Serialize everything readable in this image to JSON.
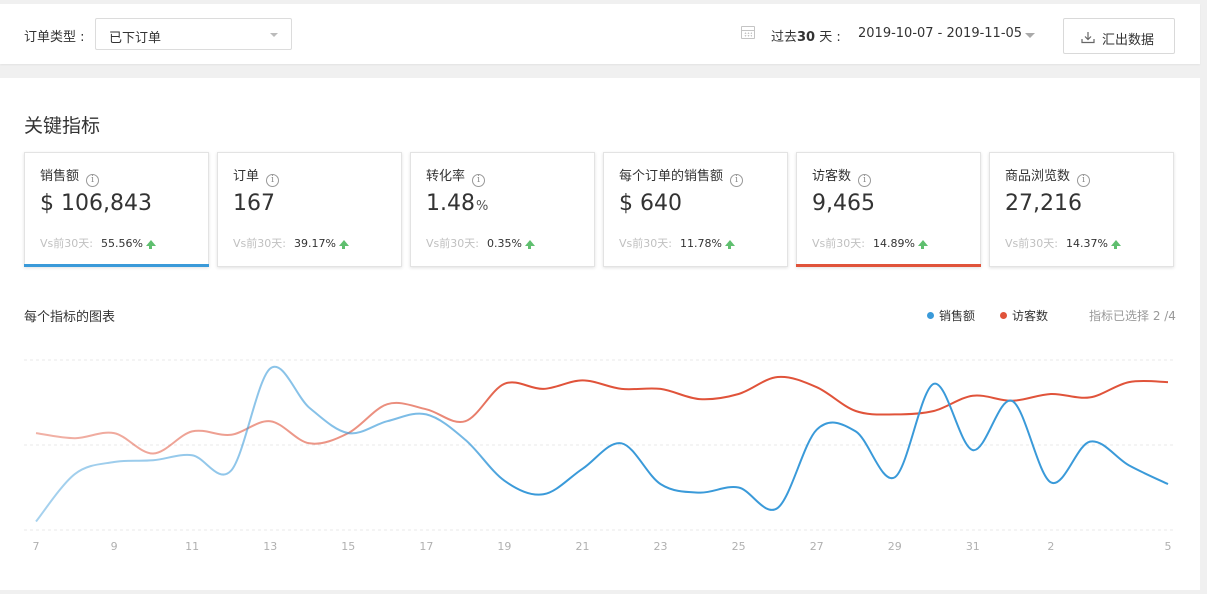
{
  "filter": {
    "order_type_label": "订单类型 :",
    "order_type_value": "已下订单",
    "range_label_prefix": "过去",
    "range_label_number": "30",
    "range_label_suffix": " 天 :",
    "range_value": "2019-10-07 - 2019-11-05",
    "export_label": "汇出数据"
  },
  "metrics": {
    "title": "关键指标",
    "cards": [
      {
        "name": "销售额",
        "value": "$ 106,843",
        "unit": "",
        "compare_label": "Vs前30天:",
        "change": "55.56%",
        "trend": "up",
        "selected": true,
        "color": "#3a9ad9"
      },
      {
        "name": "订单",
        "value": "167",
        "unit": "",
        "compare_label": "Vs前30天:",
        "change": "39.17%",
        "trend": "up",
        "selected": false,
        "color": ""
      },
      {
        "name": "转化率",
        "value": "1.48",
        "unit": "%",
        "compare_label": "Vs前30天:",
        "change": "0.35%",
        "trend": "up",
        "selected": false,
        "color": ""
      },
      {
        "name": "每个订单的销售额",
        "value": "$ 640",
        "unit": "",
        "compare_label": "Vs前30天:",
        "change": "11.78%",
        "trend": "up",
        "selected": false,
        "color": ""
      },
      {
        "name": "访客数",
        "value": "9,465",
        "unit": "",
        "compare_label": "Vs前30天:",
        "change": "14.89%",
        "trend": "up",
        "selected": true,
        "color": "#e0533a"
      },
      {
        "name": "商品浏览数",
        "value": "27,216",
        "unit": "",
        "compare_label": "Vs前30天:",
        "change": "14.37%",
        "trend": "up",
        "selected": false,
        "color": ""
      }
    ]
  },
  "chart": {
    "title": "每个指标的图表",
    "selected_count": "指标已选择 2 /4"
  },
  "chart_data": {
    "type": "line",
    "x": [
      7,
      8,
      9,
      10,
      11,
      12,
      13,
      14,
      15,
      16,
      17,
      18,
      19,
      20,
      21,
      22,
      23,
      24,
      25,
      26,
      27,
      28,
      29,
      30,
      31,
      1,
      2,
      3,
      4,
      5
    ],
    "x_ticks": [
      "7",
      "9",
      "11",
      "13",
      "15",
      "17",
      "19",
      "21",
      "23",
      "25",
      "27",
      "29",
      "31",
      "2",
      "5"
    ],
    "y_range": [
      0,
      100
    ],
    "grid": true,
    "legend_position": "top-right",
    "series": [
      {
        "name": "销售额",
        "color": "#3a9ad9",
        "values": [
          5,
          33,
          40,
          41,
          44,
          35,
          95,
          72,
          57,
          64,
          68,
          53,
          29,
          21,
          36,
          51,
          27,
          22,
          25,
          13,
          59,
          58,
          31,
          86,
          47,
          76,
          28,
          52,
          38,
          27
        ]
      },
      {
        "name": "访客数",
        "color": "#e0533a",
        "values": [
          57,
          54,
          57,
          45,
          58,
          56,
          64,
          51,
          57,
          74,
          71,
          64,
          86,
          83,
          88,
          83,
          83,
          77,
          80,
          90,
          84,
          70,
          68,
          70,
          79,
          76,
          80,
          78,
          87,
          87
        ]
      }
    ]
  }
}
